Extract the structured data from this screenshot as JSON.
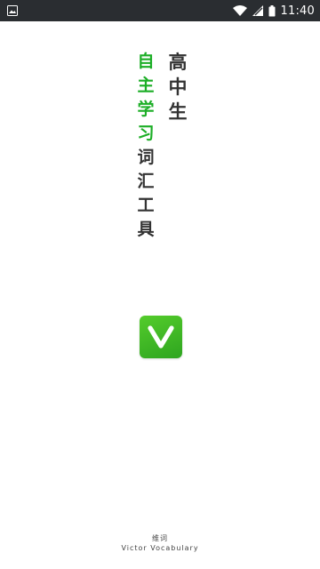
{
  "status_bar": {
    "time": "11:40",
    "icons": [
      "image-icon",
      "wifi-icon",
      "cell-signal-icon",
      "battery-icon"
    ]
  },
  "title_chars": [
    "高",
    "中",
    "生"
  ],
  "slogan_green_chars": [
    "自",
    "主",
    "学",
    "习"
  ],
  "slogan_dark_chars": [
    "词",
    "汇",
    "工",
    "具"
  ],
  "logo": {
    "letter": "V",
    "color": "#3db923"
  },
  "footer": {
    "name_cn": "维词",
    "name_en": "Victor Vocabulary"
  },
  "colors": {
    "status_bar": "#2a2d31",
    "accent_green": "#1cae26",
    "text_dark": "#333333"
  }
}
